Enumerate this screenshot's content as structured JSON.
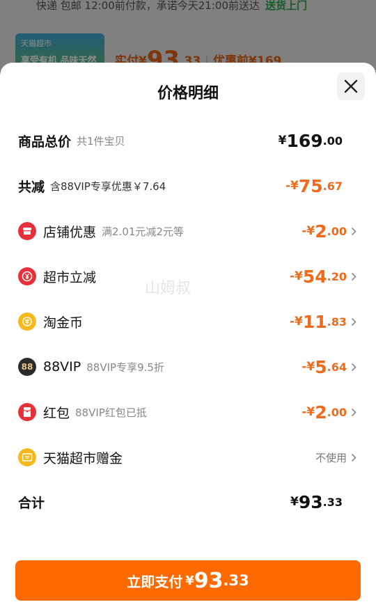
{
  "background": {
    "delivery_text": "快递 包邮  12:00前付款，承诺今天21:00前送达",
    "delivery_highlight": "送货上门",
    "thumb_line1": "天猫超市",
    "thumb_line2": "享受有机 品味天然",
    "paid_label": "实付",
    "currency": "¥",
    "paid_int": "93",
    "paid_dec": ".33",
    "orig_label": "优惠前",
    "orig_price": "¥169"
  },
  "sheet": {
    "title": "价格明细",
    "watermark": "山姆叔"
  },
  "rows": {
    "total_goods": {
      "label": "商品总价",
      "sub": "共1件宝贝",
      "prefix": "¥",
      "int": "169",
      "dec": ".00"
    },
    "discount": {
      "label": "共减",
      "sub": "含88VIP专享优惠￥7.64",
      "prefix": "-¥",
      "int": "75",
      "dec": ".67"
    },
    "shop": {
      "label": "店铺优惠",
      "sub": "满2.01元减2元等",
      "prefix": "-¥",
      "int": "2",
      "dec": ".00",
      "icon": "shop-icon"
    },
    "market": {
      "label": "超市立减",
      "sub": "",
      "prefix": "-¥",
      "int": "54",
      "dec": ".20",
      "icon": "yen-coupon-icon"
    },
    "coin": {
      "label": "淘金币",
      "sub": "",
      "prefix": "-¥",
      "int": "11",
      "dec": ".83",
      "icon": "coin-icon"
    },
    "vip": {
      "label": "88VIP",
      "sub": "88VIP专享9.5折",
      "prefix": "-¥",
      "int": "5",
      "dec": ".64",
      "icon": "88vip-icon",
      "icon_text": "88"
    },
    "redpacket": {
      "label": "红包",
      "sub": "88VIP红包已抵",
      "prefix": "-¥",
      "int": "2",
      "dec": ".00",
      "icon": "red-packet-icon"
    },
    "gift": {
      "label": "天猫超市赠金",
      "action": "不使用",
      "icon": "gift-card-icon"
    },
    "sum": {
      "label": "合计",
      "prefix": "¥",
      "int": "93",
      "dec": ".33"
    }
  },
  "pay_button": {
    "label": "立即支付",
    "prefix": "¥",
    "int": "93",
    "dec": ".33"
  },
  "colors": {
    "accent": "#ff6a00",
    "discount": "#f06a1b",
    "icon_red": "#e8303a",
    "icon_yellow": "#f6b81b"
  }
}
